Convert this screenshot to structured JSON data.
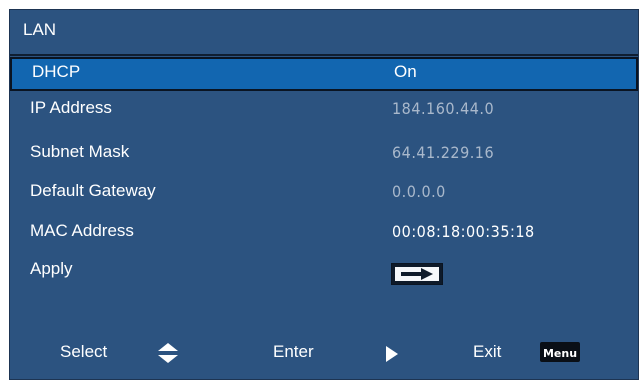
{
  "window": {
    "title": "LAN"
  },
  "menu": {
    "rows": [
      {
        "label": "DHCP",
        "value": "On"
      },
      {
        "label": "IP Address",
        "value": "184.160.44.0"
      },
      {
        "label": "Subnet Mask",
        "value": "64.41.229.16"
      },
      {
        "label": "Default Gateway",
        "value": "0.0.0.0"
      },
      {
        "label": "MAC Address",
        "value": "00:08:18:00:35:18"
      },
      {
        "label": "Apply"
      }
    ],
    "selected_row": "DHCP"
  },
  "footer": {
    "select_label": "Select",
    "enter_label": "Enter",
    "exit_label": "Exit",
    "menu_key_label": "Menu"
  },
  "icons": {
    "select": "up-down-arrows-icon",
    "enter": "play-right-icon",
    "exit": "menu-key-icon",
    "apply": "arrow-right-icon"
  },
  "colors": {
    "panel": "#2c5380",
    "highlight": "#1266b0",
    "value_dim": "#a9b8cb"
  }
}
